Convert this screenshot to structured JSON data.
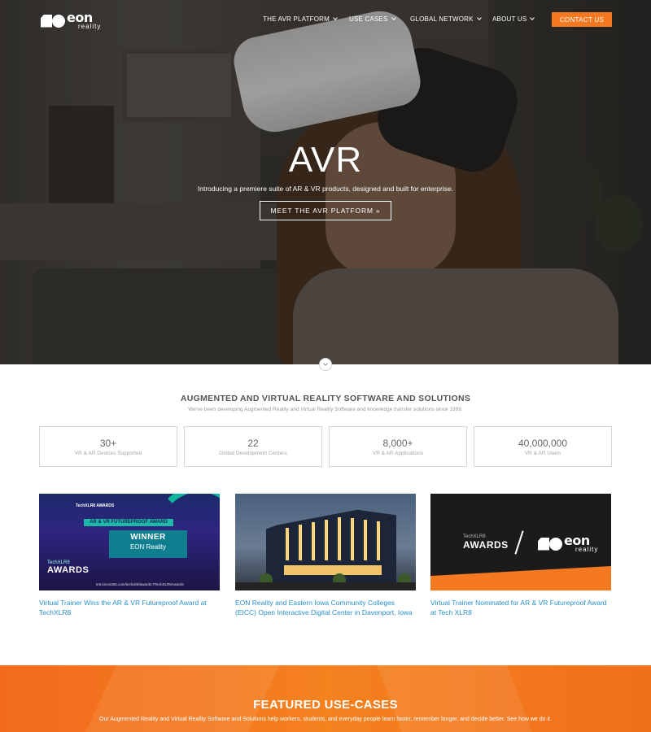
{
  "header": {
    "logo_main": "eon",
    "logo_sub": "reality",
    "nav": [
      {
        "label": "THE AVR PLATFORM"
      },
      {
        "label": "USE CASES"
      },
      {
        "label": "GLOBAL NETWORK"
      },
      {
        "label": "ABOUT US"
      }
    ],
    "cta_label": "CONTACT US"
  },
  "hero": {
    "logo_text": "AVR",
    "subtitle": "Introducing a premiere suite of AR & VR products, designed and built for enterprise.",
    "button_label": "MEET THE AVR PLATFORM »"
  },
  "solutions": {
    "title": "AUGMENTED AND VIRTUAL REALITY SOFTWARE AND SOLUTIONS",
    "subtitle": "We've been developing Augmented Reality and Virtual Reality Software and knowledge transfer solutions since 1999.",
    "stats": [
      {
        "value": "30+",
        "label": "VR & AR Devices Supported"
      },
      {
        "value": "22",
        "label": "Global Development Centers"
      },
      {
        "value": "8,000+",
        "label": "VR & AR Applications"
      },
      {
        "value": "40,000,000",
        "label": "VR & AR Users"
      }
    ]
  },
  "news": [
    {
      "caption": "Virtual Trainer Wins the AR & VR Futureproof Award at TechXLR8",
      "thumb": {
        "top_text": "TechXLR8 AWARDS",
        "ribbon": "AR & VR FUTUREPROOF AWARD",
        "winner": "WINNER",
        "winner_name": "EON Reality",
        "brand_small": "TechXLR8",
        "brand_big": "AWARDS",
        "footer": "tmt.knect365.com/techxlr8/awards   #TechXLR8Awards"
      }
    },
    {
      "caption": "EON Reality and Eastern Iowa Community Colleges (EICC) Open Interactive Digital Center in Davenport, Iowa"
    },
    {
      "caption": "Virtual Trainer Nominated for AR & VR Futureproof Award at Tech XLR8",
      "thumb": {
        "brand_small": "TechXLR8",
        "brand_big": "AWARDS",
        "logo_main": "eon",
        "logo_sub": "reality"
      }
    }
  ],
  "featured": {
    "title": "FEATURED USE-CASES",
    "subtitle": "Our Augmented Reality and Virtual Reality Software and Solutions help workers, students, and everyday people learn faster, remember longer, and decide better. See how we do it."
  },
  "colors": {
    "accent": "#f47920",
    "link": "#2a8fc9"
  }
}
